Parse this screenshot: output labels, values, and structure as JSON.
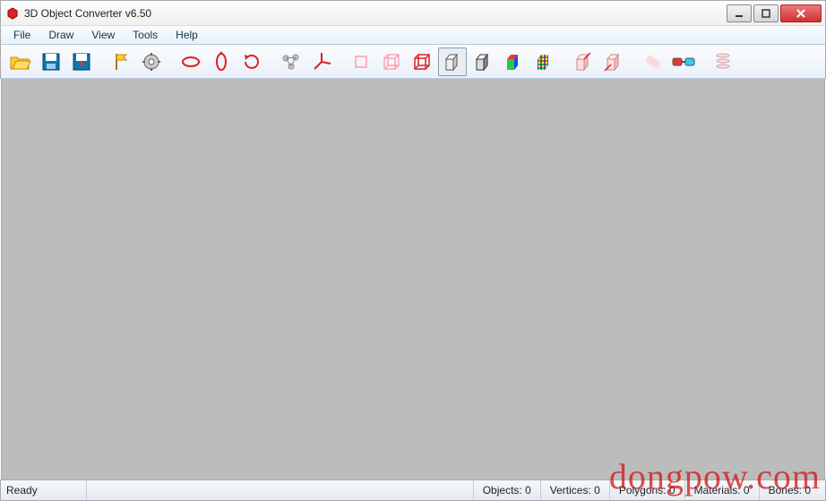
{
  "window": {
    "title": "3D Object Converter v6.50"
  },
  "menu": {
    "items": [
      "File",
      "Draw",
      "View",
      "Tools",
      "Help"
    ]
  },
  "toolbar": {
    "buttons": [
      {
        "name": "open-icon"
      },
      {
        "name": "save-icon"
      },
      {
        "name": "save-favorite-icon"
      },
      {
        "name": "flag-icon"
      },
      {
        "name": "settings-icon"
      },
      {
        "name": "rotate-x-icon"
      },
      {
        "name": "rotate-y-icon"
      },
      {
        "name": "rotate-z-icon"
      },
      {
        "name": "vertices-icon"
      },
      {
        "name": "axes-icon"
      },
      {
        "name": "wire-front-icon"
      },
      {
        "name": "wire-cube-icon"
      },
      {
        "name": "wire-red-icon"
      },
      {
        "name": "solid-cube-icon",
        "active": true
      },
      {
        "name": "shaded-cube-icon"
      },
      {
        "name": "color-cube-icon"
      },
      {
        "name": "checker-cube-icon"
      },
      {
        "name": "cube-normal-a-icon"
      },
      {
        "name": "cube-normal-b-icon"
      },
      {
        "name": "faint-a-icon"
      },
      {
        "name": "glasses-3d-icon"
      },
      {
        "name": "stack-icon"
      }
    ]
  },
  "status": {
    "ready": "Ready",
    "objects_label": "Objects:",
    "objects_value": "0",
    "vertices_label": "Vertices:",
    "vertices_value": "0",
    "polygons_label": "Polygons:",
    "polygons_value": "0",
    "materials_label": "Materials:",
    "materials_value": "0",
    "bones_label": "Bones:",
    "bones_value": "0"
  },
  "watermark": "dongpow.com"
}
